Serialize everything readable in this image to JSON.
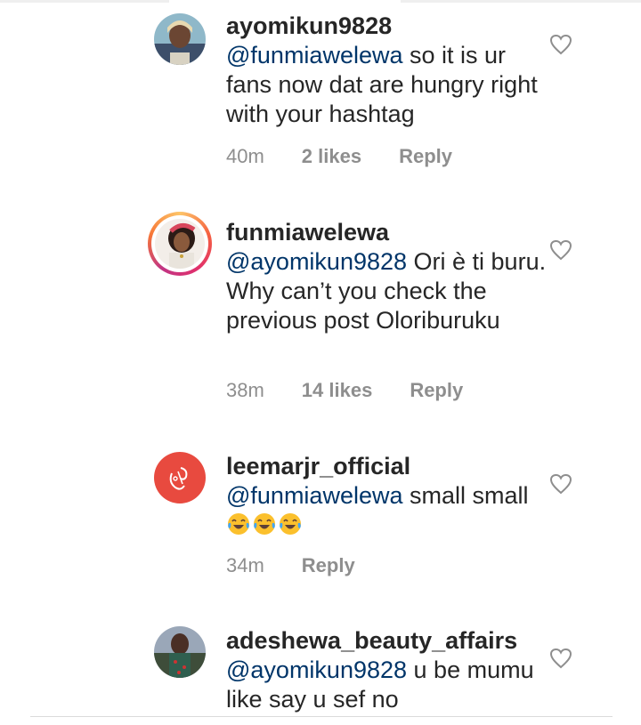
{
  "comments": [
    {
      "username": "ayomikun9828",
      "mention": "@funmiawelewa",
      "text": " so it is ur fans now dat are hungry right with your hashtag",
      "time": "40m",
      "likes": "2 likes",
      "reply": "Reply"
    },
    {
      "username": "funmiawelewa",
      "mention": "@ayomikun9828",
      "text": " Ori è ti buru. Why can’t you check the previous post Oloriburuku",
      "time": "38m",
      "likes": "14 likes",
      "reply": "Reply"
    },
    {
      "username": "leemarjr_official",
      "mention": "@funmiawelewa",
      "text": " small small",
      "time": "34m",
      "reply": "Reply"
    },
    {
      "username": "adeshewa_beauty_affairs",
      "mention": "@ayomikun9828",
      "text": " u be mumu like say u sef no"
    }
  ],
  "colors": {
    "mention": "#003569",
    "meta": "#8e8e8e",
    "avatar_red": "#e84a3f"
  },
  "icons": [
    "heart-outline-icon",
    "face-with-tears-of-joy-emoji"
  ]
}
